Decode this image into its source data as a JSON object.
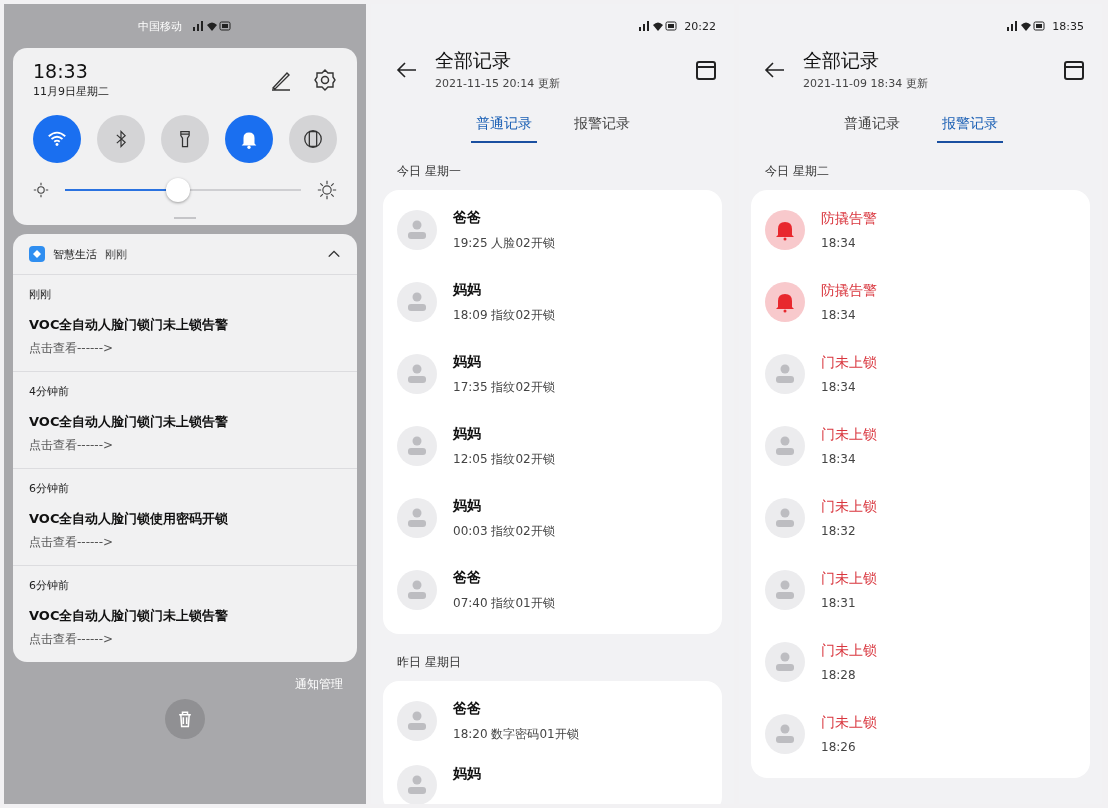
{
  "notification_shade": {
    "status_bar": {
      "carrier": "中国移动"
    },
    "time": "18:33",
    "date": "11月9日星期二",
    "toggles": [
      {
        "kind": "wifi",
        "on": true
      },
      {
        "kind": "bluetooth",
        "on": false
      },
      {
        "kind": "flashlight",
        "on": false
      },
      {
        "kind": "bell",
        "on": true
      },
      {
        "kind": "rotate",
        "on": false
      }
    ],
    "brightness": {
      "level": 0.48
    },
    "notification_group": {
      "app": "智慧生活",
      "time": "刚刚",
      "expanded": true,
      "items": [
        {
          "time": "刚刚",
          "title": "VOC全自动人脸门锁门未上锁告警",
          "link": "点击查看------>"
        },
        {
          "time": "4分钟前",
          "title": "VOC全自动人脸门锁门未上锁告警",
          "link": "点击查看------>"
        },
        {
          "time": "6分钟前",
          "title": "VOC全自动人脸门锁使用密码开锁",
          "link": "点击查看------>"
        },
        {
          "time": "6分钟前",
          "title": "VOC全自动人脸门锁门未上锁告警",
          "link": "点击查看------>"
        }
      ]
    },
    "manage_link": "通知管理"
  },
  "record_screens": [
    {
      "status_bar": {
        "time": "20:22"
      },
      "title": "全部记录",
      "updated": "2021-11-15 20:14 更新",
      "tabs": [
        {
          "label": "普通记录",
          "selected": true
        },
        {
          "label": "报警记录",
          "selected": false
        }
      ],
      "sections": [
        {
          "label": "今日 星期一",
          "rows": [
            {
              "kind": "person",
              "alarm": false,
              "title": "爸爸",
              "detail": "19:25 人脸02开锁"
            },
            {
              "kind": "person",
              "alarm": false,
              "title": "妈妈",
              "detail": "18:09 指纹02开锁"
            },
            {
              "kind": "person",
              "alarm": false,
              "title": "妈妈",
              "detail": "17:35 指纹02开锁"
            },
            {
              "kind": "person",
              "alarm": false,
              "title": "妈妈",
              "detail": "12:05 指纹02开锁"
            },
            {
              "kind": "person",
              "alarm": false,
              "title": "妈妈",
              "detail": "00:03 指纹02开锁"
            },
            {
              "kind": "person",
              "alarm": false,
              "title": "爸爸",
              "detail": "07:40 指纹01开锁"
            }
          ]
        },
        {
          "label": "昨日 星期日",
          "rows": [
            {
              "kind": "person",
              "alarm": false,
              "title": "爸爸",
              "detail": "18:20 数字密码01开锁"
            },
            {
              "kind": "person",
              "alarm": false,
              "title": "妈妈"
            }
          ]
        }
      ]
    },
    {
      "status_bar": {
        "time": "18:35"
      },
      "title": "全部记录",
      "updated": "2021-11-09 18:34 更新",
      "tabs": [
        {
          "label": "普通记录",
          "selected": false
        },
        {
          "label": "报警记录",
          "selected": true
        }
      ],
      "sections": [
        {
          "label": "今日 星期二",
          "rows": [
            {
              "kind": "bell",
              "alarm": true,
              "title": "防撬告警",
              "detail": "18:34"
            },
            {
              "kind": "bell",
              "alarm": true,
              "title": "防撬告警",
              "detail": "18:34"
            },
            {
              "kind": "person",
              "alarm": true,
              "title": "门未上锁",
              "detail": "18:34"
            },
            {
              "kind": "person",
              "alarm": true,
              "title": "门未上锁",
              "detail": "18:34"
            },
            {
              "kind": "person",
              "alarm": true,
              "title": "门未上锁",
              "detail": "18:32"
            },
            {
              "kind": "person",
              "alarm": true,
              "title": "门未上锁",
              "detail": "18:31"
            },
            {
              "kind": "person",
              "alarm": true,
              "title": "门未上锁",
              "detail": "18:28"
            },
            {
              "kind": "person",
              "alarm": true,
              "title": "门未上锁",
              "detail": "18:26"
            }
          ]
        }
      ]
    }
  ]
}
